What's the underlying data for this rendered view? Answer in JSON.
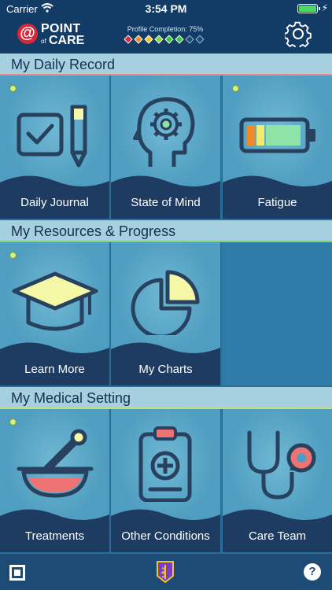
{
  "status_bar": {
    "carrier": "Carrier",
    "time": "3:54 PM"
  },
  "header": {
    "logo": {
      "point": "POINT",
      "of": "of",
      "care": "CARE"
    },
    "profile_completion": "Profile Completion: 75%",
    "diamond_colors": [
      "#d8263a",
      "#f08a2a",
      "#f0c62a",
      "#8ad13a",
      "#3ec43a",
      "#3ec43a",
      "#1e4a76",
      "#1e4a76"
    ],
    "settings_icon": "gear-icon"
  },
  "sections": [
    {
      "title": "My Daily Record",
      "tiles": [
        "Daily Journal",
        "State of Mind",
        "Fatigue"
      ]
    },
    {
      "title": "My Resources & Progress",
      "tiles": [
        "Learn More",
        "My Charts"
      ]
    },
    {
      "title": "My Medical Setting",
      "tiles": [
        "Treatments",
        "Other Conditions",
        "Care Team"
      ]
    }
  ],
  "bottom_bar": {
    "help": "?"
  }
}
